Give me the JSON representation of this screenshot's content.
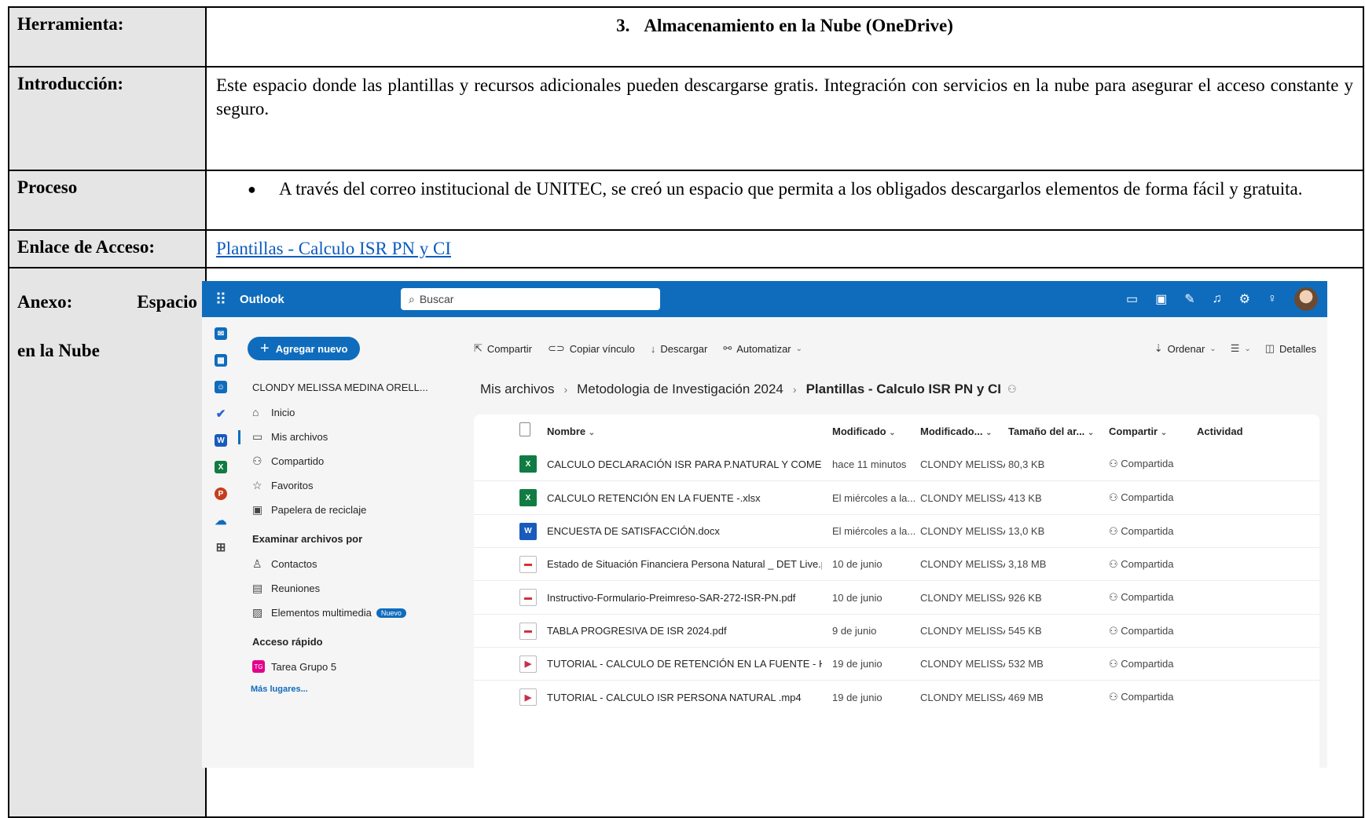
{
  "doc": {
    "herramienta_label": "Herramienta:",
    "herramienta_num": "3.",
    "herramienta_value": "Almacenamiento en la Nube (OneDrive)",
    "introduccion_label": "Introducción:",
    "introduccion_value": "Este espacio donde las plantillas y recursos adicionales pueden descargarse gratis. Integración con servicios en la nube para asegurar el acceso constante y seguro.",
    "proceso_label": "Proceso",
    "proceso_bullet": "A través del correo institucional de UNITEC, se creó un espacio que permita a los obligados descargarlos elementos de forma fácil y gratuita.",
    "enlace_label": "Enlace de Acceso:",
    "enlace_value": "Plantillas - Calculo ISR PN y CI",
    "anexo_label_1": "Anexo:",
    "anexo_label_2": "Espacio",
    "anexo_label_3": "en la Nube"
  },
  "outlook": {
    "brand": "Outlook",
    "search_placeholder": "Buscar",
    "add_button": "Agregar nuevo",
    "user_name": "CLONDY MELISSA MEDINA ORELL...",
    "nav": {
      "inicio": "Inicio",
      "mis_archivos": "Mis archivos",
      "compartido": "Compartido",
      "favoritos": "Favoritos",
      "papelera": "Papelera de reciclaje",
      "examinar_head": "Examinar archivos por",
      "contactos": "Contactos",
      "reuniones": "Reuniones",
      "multimedia": "Elementos multimedia",
      "nuevo_badge": "Nuevo",
      "acceso_head": "Acceso rápido",
      "tarea": "Tarea Grupo 5",
      "tarea_badge": "TG",
      "mas_lugares": "Más lugares..."
    },
    "cmd": {
      "compartir": "Compartir",
      "copiar": "Copiar vínculo",
      "descargar": "Descargar",
      "automatizar": "Automatizar",
      "ordenar": "Ordenar",
      "detalles": "Detalles"
    },
    "crumbs": [
      "Mis archivos",
      "Metodologia de Investigación 2024",
      "Plantillas - Calculo ISR PN y CI"
    ],
    "columns": {
      "nombre": "Nombre",
      "modificado": "Modificado",
      "modificado_por": "Modificado...",
      "tamano": "Tamaño del ar...",
      "compartir": "Compartir",
      "actividad": "Actividad"
    },
    "files": [
      {
        "type": "xlsx",
        "name": "CALCULO DECLARACIÓN ISR PARA P.NATURAL Y COMERCIAN...",
        "modified": "hace 11 minutos",
        "by": "CLONDY MELISSA I",
        "size": "80,3 KB",
        "share": "Compartida"
      },
      {
        "type": "xlsx",
        "name": "CALCULO RETENCIÓN EN LA FUENTE -.xlsx",
        "modified": "El miércoles a la...",
        "by": "CLONDY MELISSA I",
        "size": "413 KB",
        "share": "Compartida"
      },
      {
        "type": "docx",
        "name": "ENCUESTA DE SATISFACCIÓN.docx",
        "modified": "El miércoles a la...",
        "by": "CLONDY MELISSA I",
        "size": "13,0 KB",
        "share": "Compartida"
      },
      {
        "type": "pdf",
        "name": "Estado de Situación Financiera Persona Natural _ DET Live.pdf",
        "modified": "10 de junio",
        "by": "CLONDY MELISSA I",
        "size": "3,18 MB",
        "share": "Compartida"
      },
      {
        "type": "pdf",
        "name": "Instructivo-Formulario-Preimreso-SAR-272-ISR-PN.pdf",
        "modified": "10 de junio",
        "by": "CLONDY MELISSA I",
        "size": "926 KB",
        "share": "Compartida"
      },
      {
        "type": "pdf",
        "name": "TABLA PROGRESIVA DE ISR 2024.pdf",
        "modified": "9 de junio",
        "by": "CLONDY MELISSA I",
        "size": "545 KB",
        "share": "Compartida"
      },
      {
        "type": "mp4",
        "name": "TUTORIAL - CALCULO DE RETENCIÓN EN LA FUENTE - Hecho ...",
        "modified": "19 de junio",
        "by": "CLONDY MELISSA I",
        "size": "532 MB",
        "share": "Compartida"
      },
      {
        "type": "mp4",
        "name": "TUTORIAL - CALCULO ISR PERSONA NATURAL .mp4",
        "modified": "19 de junio",
        "by": "CLONDY MELISSA I",
        "size": "469 MB",
        "share": "Compartida"
      }
    ],
    "colors": {
      "brand_blue": "#0f6cbd",
      "excel_green": "#107c41",
      "word_blue": "#185abd"
    }
  }
}
